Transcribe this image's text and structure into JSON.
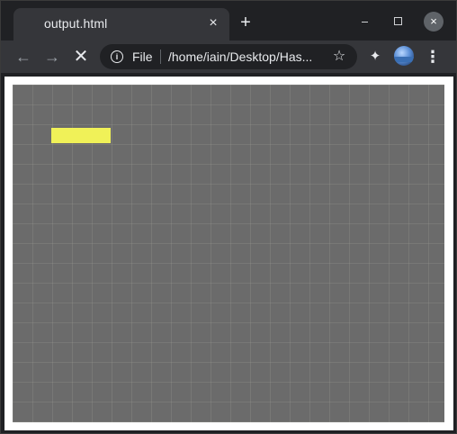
{
  "tab": {
    "title": "output.html",
    "close_glyph": "×",
    "new_tab_glyph": "+"
  },
  "window_controls": {
    "minimize_icon": "minimize-icon",
    "maximize_icon": "maximize-icon",
    "close_glyph": "×"
  },
  "toolbar": {
    "back_glyph": "←",
    "forward_glyph": "→",
    "stop_glyph": "✕",
    "site_info_glyph": "i",
    "file_label": "File",
    "url": "/home/iain/Desktop/Has...",
    "bookmark_glyph": "☆",
    "extensions_glyph": "✦",
    "menu_glyph": "⋮"
  },
  "canvas": {
    "background_color": "#6b6b6b",
    "rect_color": "#f0f158"
  }
}
